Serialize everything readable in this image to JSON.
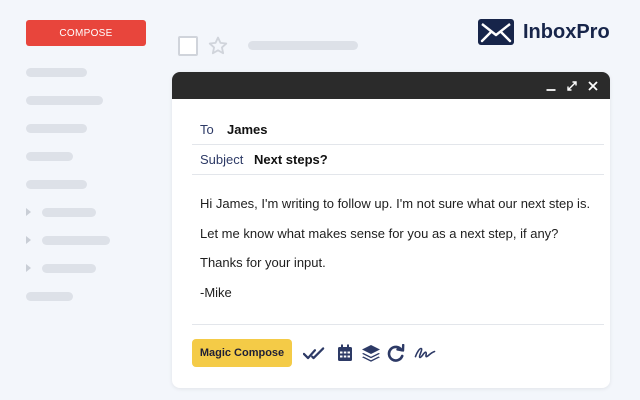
{
  "sidebar": {
    "compose_label": "COMPOSE"
  },
  "brand": {
    "name": "InboxPro",
    "icon": "envelope-icon"
  },
  "compose_window": {
    "controls": [
      "minimize-icon",
      "expand-icon",
      "close-icon"
    ],
    "to_label": "To",
    "to_value": "James",
    "subject_label": "Subject",
    "subject_value": "Next steps?",
    "body_lines": [
      "Hi James, I'm writing to follow up. I'm not sure what our next step is.",
      "Let me know what makes sense for you as a next step, if any?",
      "Thanks for your input.",
      "-Mike"
    ],
    "magic_compose_label": "Magic Compose",
    "tool_icons": [
      "double-check-icon",
      "calendar-icon",
      "layers-icon",
      "redo-icon",
      "signature-icon"
    ]
  },
  "colors": {
    "compose_button": "#e8453c",
    "magic_button": "#f4cb47",
    "brand_navy": "#17254a",
    "titlebar": "#2b2b2b"
  }
}
